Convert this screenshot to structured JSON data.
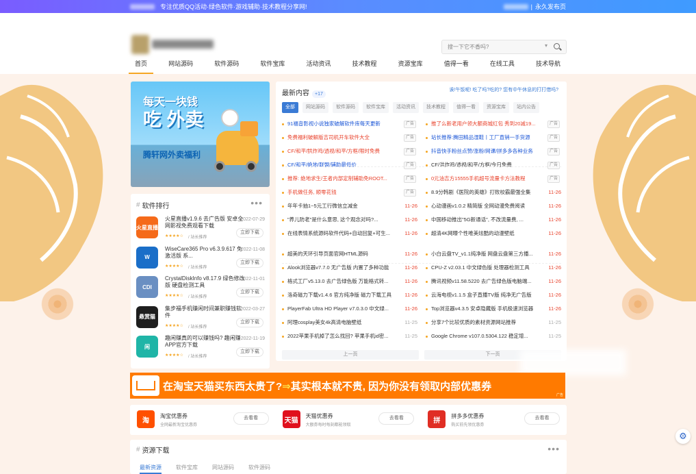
{
  "topbar": {
    "tagline": "专注优质QQ活动·绿色软件·游戏辅助·技术教程分享网!",
    "right": "永久发布页",
    "sep": "|"
  },
  "search": {
    "placeholder": "搜一下它不香吗?",
    "dropdown": "▾"
  },
  "nav": [
    "首页",
    "网站源码",
    "软件源码",
    "软件宝库",
    "活动资讯",
    "技术教程",
    "资源宝库",
    "值得一看",
    "在线工具",
    "技术导航"
  ],
  "banner": {
    "line1": "每天一块钱",
    "line2": "吃 外卖",
    "line3": "腾轩网外卖福利"
  },
  "rank": {
    "title": "软件排行",
    "hash": "#",
    "more": "•••",
    "items": [
      {
        "icon": "火星直播",
        "name": "火星直播v1.9.6 去广告版 安卓全网影视免费观看下载",
        "date": "2022-07-29",
        "stars": "★★★★☆",
        "from": "/ 站长推荐",
        "btn": "立即下载",
        "color": "#f56a1a"
      },
      {
        "icon": "W",
        "name": "WiseCare365 Pro v6.3.9.617 免激活版 系...",
        "date": "2022-11-08",
        "stars": "★★★★☆",
        "from": "/ 站长推荐",
        "btn": "立即下载",
        "color": "#1a6ec8"
      },
      {
        "icon": "CDI",
        "name": "CrystalDiskInfo v8.17.9 绿色修改版 硬盘检测工具",
        "date": "2022-11-01",
        "stars": "★★★★☆",
        "from": "/ 站长推荐",
        "btn": "立即下载",
        "color": "#6a8fc2"
      },
      {
        "icon": "悬赏猫",
        "name": "集步福手机赚闲时间兼职赚钱软件",
        "date": "2022-03-27",
        "stars": "★★★★☆",
        "from": "/ 站长推荐",
        "btn": "立即下载",
        "color": "#1e1e1e"
      },
      {
        "icon": "闲",
        "name": "趣闲赚真的可以赚钱吗? 趣闲赚APP官方下载",
        "date": "2022-11-19",
        "stars": "★★★★☆",
        "from": "/ 站长推荐",
        "btn": "立即下载",
        "color": "#1fb5a7"
      }
    ]
  },
  "latest": {
    "title": "最新内容",
    "count": "+17",
    "headlink": "诶!午饭呢! 吃了吗?吃的? 您有中午休息的打打借吗?",
    "tabs": [
      "全部",
      "网站源码",
      "软件源码",
      "软件宝库",
      "活动资讯",
      "技术教程",
      "值得一看",
      "资源宝库",
      "站内公告"
    ],
    "ads": [
      {
        "text": "91福音影视小说独家破解软件库每天更新",
        "color": "#1a55d6",
        "tag": "广告"
      },
      {
        "text": "推了么新老用户领大额商城红包 秀到20减19...",
        "color": "#e8402a",
        "tag": "广告"
      },
      {
        "text": "免费福利破解版吉司机开车软件大全",
        "color": "#e8402a",
        "tag": "广告"
      },
      {
        "text": "站长推荐:腾田精品湿鞋丨工厂直销一手货源",
        "color": "#1a55d6",
        "tag": "广告"
      },
      {
        "text": "CF/和平/拱炸鸡/透视/和平/方框/限时免费",
        "color": "#e8402a",
        "tag": "广告"
      },
      {
        "text": "抖音快手粉丝点赞/涨粉/网课/拼多多各种业务",
        "color": "#1a55d6",
        "tag": "广告"
      },
      {
        "text": "CF/和平/绝地/联盟/辅助最低价",
        "color": "#1a55d6",
        "tag": "广告"
      },
      {
        "text": "CF/洪炸鸡/透视/和平/方框/今日免费",
        "color": "#333",
        "tag": "广告"
      },
      {
        "text": "推荐: 绝地求生/王者内部定制辅助免ROOT...",
        "color": "#e8402a",
        "tag": "广告"
      },
      {
        "text": "0元油吉方15555手机超号流量卡方法教程",
        "color": "#e8402a",
        "tag": "广告"
      },
      {
        "text": "手机做任务, 顺零花钱",
        "color": "#e8402a",
        "tag": "广告"
      }
    ],
    "items": [
      {
        "text": "8.9分韩剧《医院的英雄》打败校霸最强全集",
        "date": "11-26",
        "grey": false
      },
      {
        "text": "年年卡抽1~5元工行微信立减金",
        "date": "11-26",
        "grey": false
      },
      {
        "text": "心动漫画v1.0.2 精简版 全网动漫免费阅读",
        "date": "11-26",
        "grey": false
      },
      {
        "text": "\"养儿防老\"是什么意思, 这个观念对吗?...",
        "date": "11-26",
        "grey": false
      },
      {
        "text": "中国移动推出\"5G新通话\", 不改流量费, ...",
        "date": "11-26",
        "grey": false
      },
      {
        "text": "在线表情系统源码软件代码+自动回复+可生...",
        "date": "11-26",
        "grey": false
      },
      {
        "text": "超清4K网曝个性唯美炫酷的动漫壁纸",
        "date": "11-26",
        "grey": false
      },
      {
        "text": "超美的天环引导页面官网HTML源码",
        "date": "11-26",
        "grey": false
      },
      {
        "text": "小白云盘TV_v1.1纯净版 网盘云盘第三方播...",
        "date": "11-26",
        "grey": false
      },
      {
        "text": "Alook浏览器v7.7.0 无广告版 内置了多种功能",
        "date": "11-26",
        "grey": false
      },
      {
        "text": "CPU-Z v2.03.1 中文绿色版 处理器检测工具",
        "date": "11-26",
        "grey": false
      },
      {
        "text": "格式工厂v5.13.0 去广告绿色版 万能格式转...",
        "date": "11-26",
        "grey": false
      },
      {
        "text": "腾讯视频v11.58.5220 去广告绿色版电脑端...",
        "date": "11-26",
        "grey": false
      },
      {
        "text": "洛奇磁力下载v1.4.6 官方纯净版 磁力下载工具",
        "date": "11-26",
        "grey": false
      },
      {
        "text": "云海电视v1.1.5 盒子直播TV版 纯净无广告版",
        "date": "11-26",
        "grey": false
      },
      {
        "text": "PlayerFab Ultra HD Player v7.0.3.0 中文绿...",
        "date": "11-26",
        "grey": false
      },
      {
        "text": "Top浏览器v4.3.5 安卓隐藏版 手机极速浏览器",
        "date": "11-26",
        "grey": false
      },
      {
        "text": "阿理cosplay美女4k高清电脑壁纸",
        "date": "11-25",
        "grey": true
      },
      {
        "text": "分享7个比较优质的素材资源网站推荐",
        "date": "11-25",
        "grey": true
      },
      {
        "text": "2022苹果手机掉了怎么找回? 苹果手机id密...",
        "date": "11-25",
        "grey": true
      },
      {
        "text": "Google Chrome v107.0.5304.122 稳定增...",
        "date": "11-25",
        "grey": true
      }
    ],
    "prev": "上一页",
    "next": "下一页"
  },
  "ad2": {
    "part1": "在淘宝天猫买东西太贵了?",
    "arrow": "⇒",
    "part2": "其实根本就不贵, 因为你没有领取内部优惠券",
    "mark": "广告"
  },
  "coupons": [
    {
      "icon": "淘",
      "name": "淘宝优惠券",
      "desc": "全网最新淘宝优惠券",
      "btn": "去看看",
      "color": "#ff5000"
    },
    {
      "icon": "天猫",
      "name": "天猫优惠券",
      "desc": "大额券每时每刻都能领取",
      "btn": "去看看",
      "color": "#e0101d"
    },
    {
      "icon": "拼",
      "name": "拼多多优惠券",
      "desc": "购买前先领优惠券",
      "btn": "去看看",
      "color": "#e02e24"
    }
  ],
  "resources": {
    "title": "资源下载",
    "hash": "#",
    "more": "•••",
    "tabs": [
      "最新资源",
      "软件宝库",
      "网站源码",
      "软件源码"
    ]
  },
  "gear": "⚙"
}
